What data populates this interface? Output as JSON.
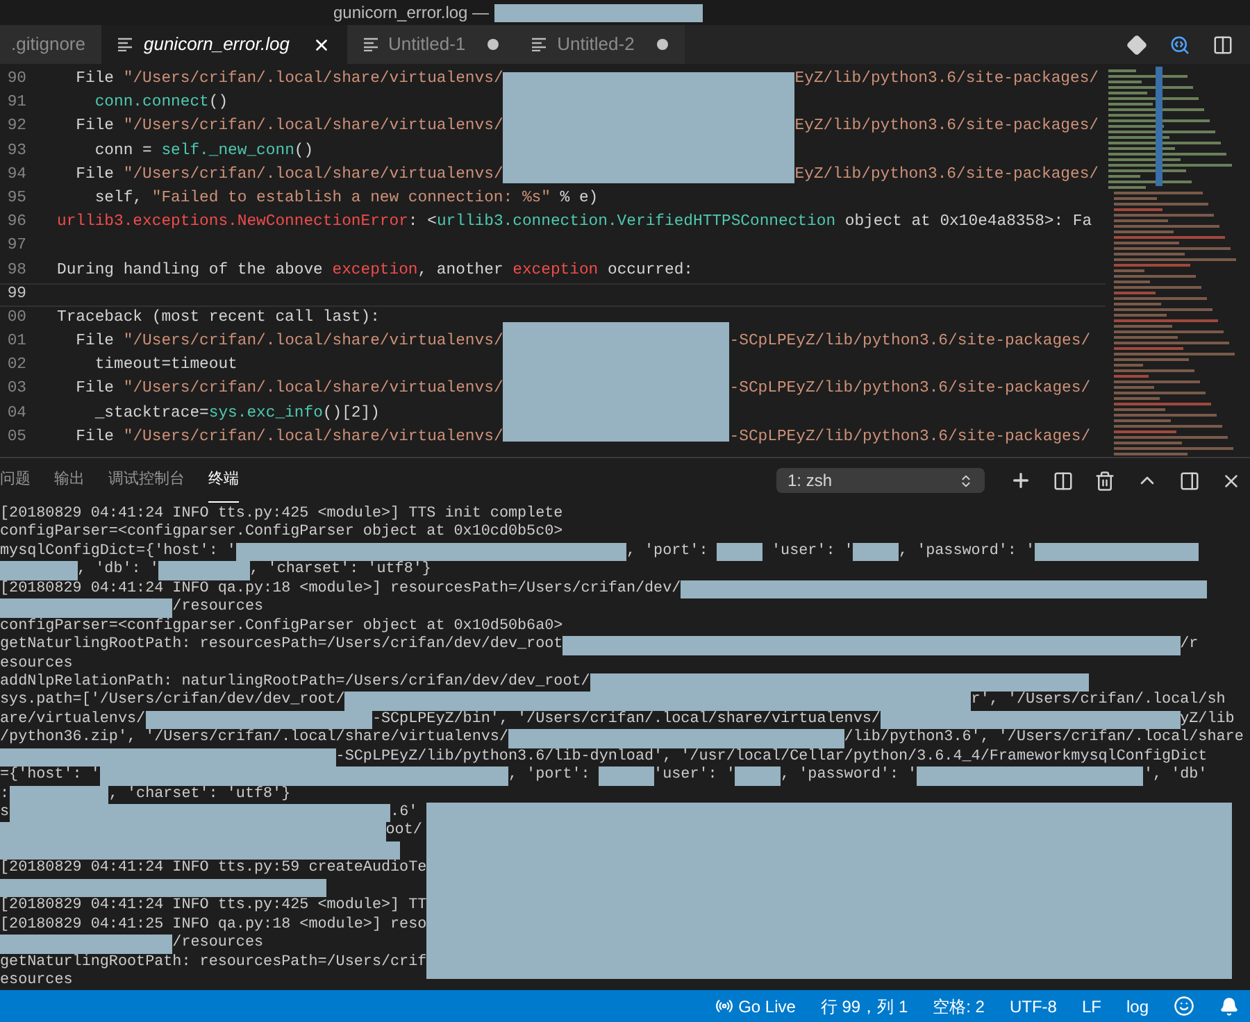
{
  "window": {
    "title": "gunicorn_error.log —"
  },
  "tabs": [
    {
      "label": ".gitignore",
      "selected": false,
      "dirty": false,
      "icon": false
    },
    {
      "label": "gunicorn_error.log",
      "selected": true,
      "dirty": false,
      "icon": true
    },
    {
      "label": "Untitled-1",
      "selected": false,
      "dirty": true,
      "icon": true
    },
    {
      "label": "Untitled-2",
      "selected": false,
      "dirty": true,
      "icon": true
    }
  ],
  "editor": {
    "lines": [
      {
        "number": "90",
        "current": false,
        "segments": [
          {
            "kind": "plain",
            "text": "  File "
          },
          {
            "kind": "string",
            "text": "\"/Users/crifan/.local/share/virtualenvs/"
          },
          {
            "kind": "redacted"
          },
          {
            "kind": "string",
            "text": "EyZ/lib/python3.6/site-packages/"
          }
        ]
      },
      {
        "number": "91",
        "current": false,
        "segments": [
          {
            "kind": "ident",
            "text": "    conn.connect"
          },
          {
            "kind": "plain",
            "text": "()"
          }
        ]
      },
      {
        "number": "92",
        "current": false,
        "segments": [
          {
            "kind": "plain",
            "text": "  File "
          },
          {
            "kind": "string",
            "text": "\"/Users/crifan/.local/share/virtualenvs/"
          },
          {
            "kind": "redacted"
          },
          {
            "kind": "string",
            "text": "EyZ/lib/python3.6/site-packages/"
          }
        ]
      },
      {
        "number": "93",
        "current": false,
        "segments": [
          {
            "kind": "plain",
            "text": "    conn = "
          },
          {
            "kind": "ident",
            "text": "self._new_conn"
          },
          {
            "kind": "plain",
            "text": "()"
          }
        ]
      },
      {
        "number": "94",
        "current": false,
        "segments": [
          {
            "kind": "plain",
            "text": "  File "
          },
          {
            "kind": "string",
            "text": "\"/Users/crifan/.local/share/virtualenvs/"
          },
          {
            "kind": "redacted"
          },
          {
            "kind": "string",
            "text": "EyZ/lib/python3.6/site-packages/"
          }
        ]
      },
      {
        "number": "95",
        "current": false,
        "segments": [
          {
            "kind": "plain",
            "text": "    self, "
          },
          {
            "kind": "string",
            "text": "\"Failed to establish a new connection: %s\""
          },
          {
            "kind": "plain",
            "text": " % e)"
          }
        ]
      },
      {
        "number": "96",
        "current": false,
        "segments": [
          {
            "kind": "error",
            "text": "urllib3.exceptions.NewConnectionError"
          },
          {
            "kind": "plain",
            "text": ": <"
          },
          {
            "kind": "ident",
            "text": "urllib3.connection.VerifiedHTTPSConnection"
          },
          {
            "kind": "plain",
            "text": " object at 0x10e4a8358>: Fa"
          }
        ]
      },
      {
        "number": "97",
        "current": false
      },
      {
        "number": "98",
        "current": false,
        "segments": [
          {
            "kind": "plain",
            "text": "During handling of the above "
          },
          {
            "kind": "error",
            "text": "exception"
          },
          {
            "kind": "plain",
            "text": ", another "
          },
          {
            "kind": "error",
            "text": "exception"
          },
          {
            "kind": "plain",
            "text": " occurred:"
          }
        ]
      },
      {
        "number": "99",
        "current": true
      },
      {
        "number": "00",
        "current": false,
        "segments": [
          {
            "kind": "plain",
            "text": "Traceback (most recent call last):"
          }
        ]
      },
      {
        "number": "01",
        "current": false,
        "segments": [
          {
            "kind": "plain",
            "text": "  File "
          },
          {
            "kind": "string",
            "text": "\"/Users/crifan/.local/share/virtualenvs/"
          },
          {
            "kind": "redacted"
          },
          {
            "kind": "string",
            "text": "-SCpLPEyZ/lib/python3.6/site-packages/"
          }
        ]
      },
      {
        "number": "02",
        "current": false,
        "segments": [
          {
            "kind": "plain",
            "text": "    timeout=timeout"
          }
        ]
      },
      {
        "number": "03",
        "current": false,
        "segments": [
          {
            "kind": "plain",
            "text": "  File "
          },
          {
            "kind": "string",
            "text": "\"/Users/crifan/.local/share/virtualenvs/"
          },
          {
            "kind": "redacted"
          },
          {
            "kind": "string",
            "text": "-SCpLPEyZ/lib/python3.6/site-packages/"
          }
        ]
      },
      {
        "number": "04",
        "current": false,
        "segments": [
          {
            "kind": "plain",
            "text": "    _stacktrace="
          },
          {
            "kind": "ident",
            "text": "sys.exc_info"
          },
          {
            "kind": "plain",
            "text": "()[2])"
          }
        ]
      },
      {
        "number": "05",
        "current": false,
        "segments": [
          {
            "kind": "plain",
            "text": "  File "
          },
          {
            "kind": "string",
            "text": "\"/Users/crifan/.local/share/virtualenvs/"
          },
          {
            "kind": "redacted"
          },
          {
            "kind": "string",
            "text": "-SCpLPEyZ/lib/python3.6/site-packages/"
          }
        ]
      }
    ]
  },
  "panel": {
    "tabs": [
      {
        "label": "问题",
        "selected": false
      },
      {
        "label": "输出",
        "selected": false
      },
      {
        "label": "调试控制台",
        "selected": false
      },
      {
        "label": "终端",
        "selected": true
      }
    ],
    "terminal_select": "1: zsh",
    "terminal_rows": [
      {
        "segments": [
          {
            "kind": "text",
            "text": "[20180829 04:41:24 INFO tts.py:425 <module>] TTS init complete"
          }
        ]
      },
      {
        "segments": [
          {
            "kind": "text",
            "text": "configParser=<configparser.ConfigParser object at 0x10cd0b5c0>"
          }
        ]
      },
      {
        "segments": [
          {
            "kind": "text",
            "text": "mysqlConfigDict={'host': '"
          },
          {
            "kind": "redacted"
          },
          {
            "kind": "text",
            "text": ", 'port': "
          },
          {
            "kind": "redacted"
          },
          {
            "kind": "text",
            "text": " 'user': '"
          },
          {
            "kind": "redacted"
          },
          {
            "kind": "text",
            "text": ", 'password': '"
          },
          {
            "kind": "redacted"
          }
        ]
      },
      {
        "segments": [
          {
            "kind": "redacted"
          },
          {
            "kind": "text",
            "text": ", 'db': '"
          },
          {
            "kind": "redacted"
          },
          {
            "kind": "text",
            "text": ", 'charset': 'utf8'}"
          }
        ]
      },
      {
        "segments": [
          {
            "kind": "text",
            "text": "[20180829 04:41:24 INFO qa.py:18 <module>] resourcesPath=/Users/crifan/dev/"
          },
          {
            "kind": "redacted"
          }
        ]
      },
      {
        "segments": [
          {
            "kind": "redacted"
          },
          {
            "kind": "text",
            "text": "/resources"
          }
        ]
      },
      {
        "segments": [
          {
            "kind": "text",
            "text": "configParser=<configparser.ConfigParser object at 0x10d50b6a0>"
          }
        ]
      },
      {
        "segments": [
          {
            "kind": "text",
            "text": "getNaturlingRootPath: resourcesPath=/Users/crifan/dev/dev_root"
          },
          {
            "kind": "redacted"
          },
          {
            "kind": "text",
            "text": "/r"
          }
        ]
      },
      {
        "segments": [
          {
            "kind": "text",
            "text": "esources"
          }
        ]
      },
      {
        "segments": [
          {
            "kind": "text",
            "text": "addNlpRelationPath: naturlingRootPath=/Users/crifan/dev/dev_root/"
          },
          {
            "kind": "redacted"
          }
        ]
      },
      {
        "segments": [
          {
            "kind": "text",
            "text": "sys.path=['/Users/crifan/dev/dev_root/"
          },
          {
            "kind": "redacted"
          },
          {
            "kind": "text",
            "text": "r', '/Users/crifan/.local/sh"
          }
        ]
      },
      {
        "segments": [
          {
            "kind": "text",
            "text": "are/virtualenvs/"
          },
          {
            "kind": "redacted"
          },
          {
            "kind": "text",
            "text": "-SCpLPEyZ/bin', '/Users/crifan/.local/share/virtualenvs/"
          },
          {
            "kind": "redacted"
          },
          {
            "kind": "text",
            "text": "yZ/lib"
          }
        ]
      },
      {
        "segments": [
          {
            "kind": "text",
            "text": "/python36.zip', '/Users/crifan/.local/share/virtualenvs/"
          },
          {
            "kind": "redacted"
          },
          {
            "kind": "text",
            "text": "/lib/python3.6', '/Users/crifan/.local/share"
          }
        ]
      },
      {
        "segments": [
          {
            "kind": "redacted"
          },
          {
            "kind": "text",
            "text": "-SCpLPEyZ/lib/python3.6/lib-dynload', '/usr/local/Cellar/python/3.6.4_4/FrameworkmysqlConfigDict"
          }
        ]
      },
      {
        "segments": [
          {
            "kind": "text",
            "text": "={'host': '"
          },
          {
            "kind": "redacted"
          },
          {
            "kind": "text",
            "text": ", 'port': "
          },
          {
            "kind": "redacted"
          },
          {
            "kind": "text",
            "text": "'user': '"
          },
          {
            "kind": "redacted"
          },
          {
            "kind": "text",
            "text": ", 'password': '"
          },
          {
            "kind": "redacted"
          },
          {
            "kind": "text",
            "text": "', 'db'"
          }
        ]
      },
      {
        "segments": [
          {
            "kind": "text",
            "text": ":"
          },
          {
            "kind": "redacted"
          },
          {
            "kind": "text",
            "text": ", 'charset': 'utf8'}"
          }
        ]
      },
      {
        "segments": [
          {
            "kind": "text",
            "text": "s"
          },
          {
            "kind": "redacted"
          },
          {
            "kind": "text",
            "text": ".6'"
          }
        ]
      },
      {
        "segments": [
          {
            "kind": "redacted"
          },
          {
            "kind": "text",
            "text": "oot/"
          }
        ]
      },
      {
        "segments": [
          {
            "kind": "redacted"
          }
        ]
      },
      {
        "segments": [
          {
            "kind": "text",
            "text": "[20180829 04:41:24 INFO tts.py:59 createAudioTe"
          }
        ]
      },
      {
        "segments": [
          {
            "kind": "redacted"
          }
        ]
      },
      {
        "segments": [
          {
            "kind": "text",
            "text": "[20180829 04:41:24 INFO tts.py:425 <module>] TT"
          }
        ]
      },
      {
        "segments": [
          {
            "kind": "text",
            "text": "[20180829 04:41:25 INFO qa.py:18 <module>] reso"
          }
        ]
      },
      {
        "segments": [
          {
            "kind": "redacted"
          },
          {
            "kind": "text",
            "text": "/resources"
          }
        ]
      },
      {
        "segments": [
          {
            "kind": "text",
            "text": "getNaturlingRootPath: resourcesPath=/Users/crif"
          }
        ]
      },
      {
        "segments": [
          {
            "kind": "text",
            "text": "esources"
          }
        ]
      }
    ]
  },
  "status_bar": {
    "items": [
      {
        "kind": "live",
        "text": "Go Live"
      },
      {
        "kind": "text",
        "text": "行 99，列 1"
      },
      {
        "kind": "text",
        "text": "空格: 2"
      },
      {
        "kind": "text",
        "text": "UTF-8"
      },
      {
        "kind": "text",
        "text": "LF"
      },
      {
        "kind": "text",
        "text": "log"
      },
      {
        "kind": "feedback"
      },
      {
        "kind": "bell"
      }
    ]
  }
}
